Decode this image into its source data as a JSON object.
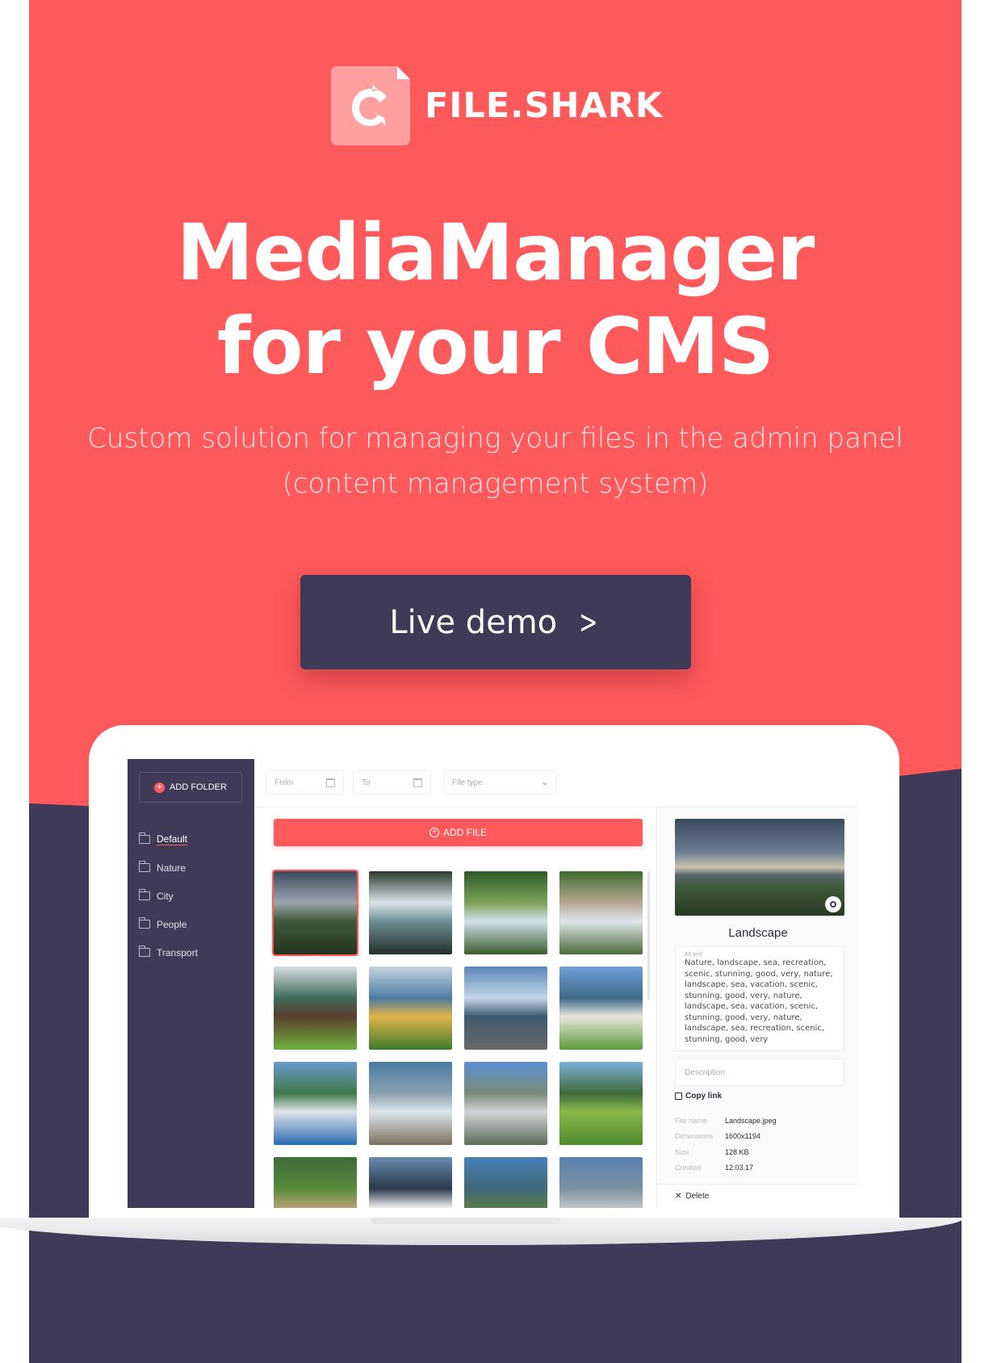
{
  "brand": {
    "name": "FILE.SHARK",
    "logo_icon": "shark-file-icon"
  },
  "hero": {
    "headline_line1": "MediaManager",
    "headline_line2": "for your CMS",
    "subtitle": "Custom solution for managing your files in the admin panel (content management system)",
    "cta_label": "Live demo",
    "cta_icon": "chevron-right-icon"
  },
  "colors": {
    "accent": "#fe595b",
    "dark": "#3e3a57",
    "logo_tile": "#fea0a0"
  },
  "app": {
    "sidebar": {
      "add_folder_label": "ADD FOLDER",
      "folders": [
        {
          "label": "Default",
          "active": true
        },
        {
          "label": "Nature",
          "active": false
        },
        {
          "label": "City",
          "active": false
        },
        {
          "label": "People",
          "active": false
        },
        {
          "label": "Transport",
          "active": false
        }
      ]
    },
    "filters": {
      "from_placeholder": "From",
      "to_placeholder": "To",
      "file_type_placeholder": "File type"
    },
    "add_file_label": "ADD FILE",
    "thumbnails": [
      {
        "subject": "cloudy valley landscape",
        "selected": true
      },
      {
        "subject": "waterfall",
        "selected": false
      },
      {
        "subject": "forest stream",
        "selected": false
      },
      {
        "subject": "cabin by river",
        "selected": false
      },
      {
        "subject": "wooden chalet",
        "selected": false
      },
      {
        "subject": "yellow house",
        "selected": false
      },
      {
        "subject": "mountain town",
        "selected": false
      },
      {
        "subject": "villa on hill",
        "selected": false
      },
      {
        "subject": "lakeside village",
        "selected": false
      },
      {
        "subject": "mountain lake",
        "selected": false
      },
      {
        "subject": "mountain peak town",
        "selected": false
      },
      {
        "subject": "green valley",
        "selected": false
      },
      {
        "subject": "horses grazing",
        "selected": false
      },
      {
        "subject": "alpine rocks",
        "selected": false
      },
      {
        "subject": "bridge valley",
        "selected": false
      },
      {
        "subject": "town view",
        "selected": false
      }
    ],
    "details": {
      "title": "Landscape",
      "alt_label": "Alt text",
      "alt_text": "Nature, landscape, sea, recreation, scenic, stunning, good, very, nature, landscape, sea, vacation, scenic, stunning, good, very, nature, landscape, sea, vacation, scenic, stunning, good, very, nature, landscape, sea, recreation, scenic, stunning, good, very",
      "description_placeholder": "Description",
      "copy_link_label": "Copy link",
      "meta": [
        {
          "key": "File name",
          "value": "Landscape.jpeg"
        },
        {
          "key": "Dimensions",
          "value": "1600x1194"
        },
        {
          "key": "Size",
          "value": "128 KB"
        },
        {
          "key": "Created",
          "value": "12.03.17"
        }
      ],
      "delete_label": "Delete"
    }
  }
}
